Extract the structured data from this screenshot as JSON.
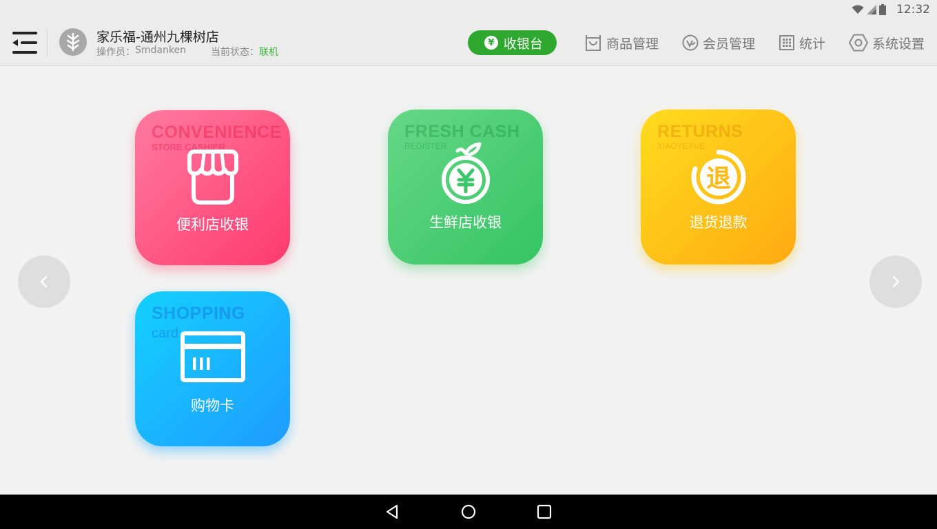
{
  "status_bar": {
    "time": "12:32",
    "icons": [
      "wifi-icon",
      "signal-icon",
      "battery-icon"
    ]
  },
  "header": {
    "menu_icon": "menu-icon",
    "store_logo_icon": "leaf-icon",
    "store_name": "家乐福-通州九棵树店",
    "operator_label": "操作员：",
    "operator_name": "Smdanken",
    "status_label": "当前状态：",
    "status_value": "联机",
    "status_color": "#3bb13b"
  },
  "nav": {
    "active": {
      "label": "收银台",
      "icon": "yen-icon",
      "color": "#2ea82e"
    },
    "items": [
      {
        "label": "商品管理",
        "icon": "shopping-bag-icon"
      },
      {
        "label": "会员管理",
        "icon": "member-v-icon"
      },
      {
        "label": "统计",
        "icon": "grid-stats-icon"
      },
      {
        "label": "系统设置",
        "icon": "settings-hex-icon"
      }
    ]
  },
  "tiles": [
    {
      "id": "convenience",
      "bg_title": "CONVENIENCE",
      "bg_sub": "STORE CASHIER",
      "label": "便利店收银",
      "icon": "storefront-icon",
      "color_from": "#ff7aa0",
      "color_to": "#ff3a6e"
    },
    {
      "id": "fresh",
      "bg_title": "FRESH CASH",
      "bg_sub": "REGISTER",
      "label": "生鲜店收银",
      "icon": "fruit-yen-icon",
      "color_from": "#66d888",
      "color_to": "#35c462"
    },
    {
      "id": "returns",
      "bg_title": "RETURNS",
      "bg_sub": "XIAOYEYUE",
      "label": "退货退款",
      "icon": "refund-icon",
      "icon_char": "退",
      "color_from": "#ffdc1e",
      "color_to": "#ffaa12"
    },
    {
      "id": "shopping-card",
      "bg_title": "SHOPPING",
      "bg_sub": "card",
      "label": "购物卡",
      "icon": "card-icon",
      "color_from": "#14d0ff",
      "color_to": "#1e9cff"
    }
  ],
  "pager": {
    "prev_icon": "chevron-left-icon",
    "next_icon": "chevron-right-icon"
  },
  "system_nav": {
    "icons": [
      "back-icon",
      "home-icon",
      "recent-apps-icon"
    ]
  }
}
